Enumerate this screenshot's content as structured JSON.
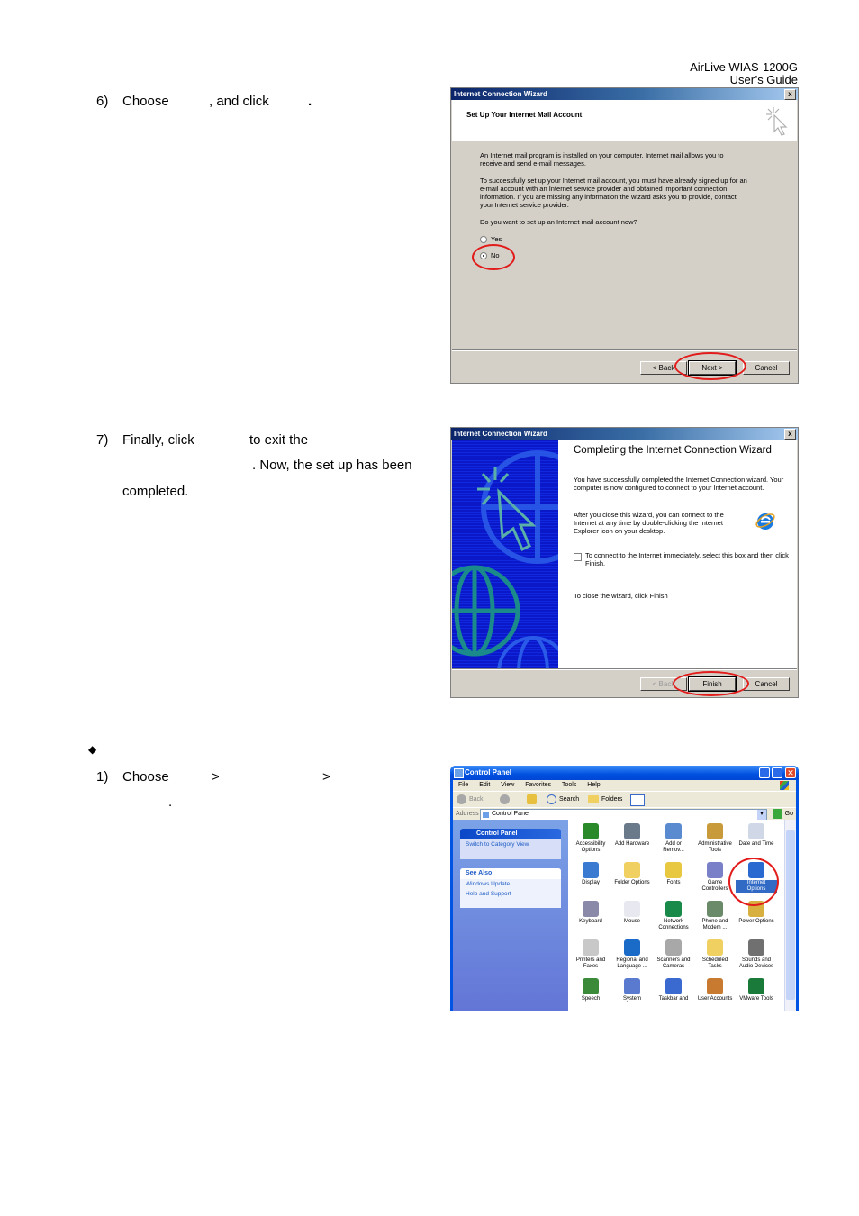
{
  "header": {
    "line1": "AirLive  WIAS-1200G",
    "line2": "User’s  Guide"
  },
  "steps": {
    "s6": {
      "num": "6)",
      "a": "Choose",
      "b": ", and click",
      "c": "."
    },
    "s7": {
      "num": "7)",
      "a": "Finally, click",
      "b": "to exit the",
      "c": ". Now, the set up has been",
      "d": "completed."
    },
    "bullet": "◆",
    "s1": {
      "num": "1)",
      "a": "Choose",
      "gt1": ">",
      "gt2": ">",
      "dot": "."
    }
  },
  "wizard1": {
    "title": "Internet Connection Wizard",
    "close": "x",
    "heading": "Set Up Your Internet Mail Account",
    "p1": "An Internet mail program is installed on your computer. Internet mail allows you to receive and send e-mail messages.",
    "p2": "To successfully set up your Internet mail account, you must have already signed up for an e-mail account with an Internet service provider and obtained important connection information. If you are missing any information the wizard asks you to provide, contact your Internet service provider.",
    "question": "Do you want to set up an Internet mail account now?",
    "options": [
      {
        "label": "Yes",
        "selected": false
      },
      {
        "label": "No",
        "selected": true
      }
    ],
    "buttons": {
      "back": "< Back",
      "next": "Next >",
      "cancel": "Cancel"
    }
  },
  "wizard2": {
    "title": "Internet Connection Wizard",
    "close": "x",
    "heading": "Completing the Internet Connection Wizard",
    "p1": "You have successfully completed the Internet Connection wizard. Your computer is now configured to connect to your Internet account.",
    "p2": "After you close this wizard, you can connect to the Internet at any time by double-clicking the Internet Explorer icon on your desktop.",
    "checkbox": {
      "label": "To connect to the Internet immediately, select this box and then click Finish.",
      "checked": false
    },
    "p3": "To close the wizard, click Finish",
    "buttons": {
      "back": "< Back",
      "finish": "Finish",
      "cancel": "Cancel"
    }
  },
  "control_panel": {
    "title": "Control Panel",
    "menu": [
      "File",
      "Edit",
      "View",
      "Favorites",
      "Tools",
      "Help"
    ],
    "toolbar": {
      "back": "Back",
      "search": "Search",
      "folders": "Folders"
    },
    "address": {
      "label": "Address",
      "value": "Control Panel",
      "go": "Go"
    },
    "panes": [
      {
        "title": "Control Panel",
        "items": [
          "Switch to Category View"
        ]
      },
      {
        "title": "See Also",
        "items": [
          "Windows Update",
          "Help and Support"
        ]
      }
    ],
    "icons": [
      {
        "l1": "Accessibility",
        "l2": "Options",
        "color": "#2a8a2a"
      },
      {
        "l1": "Add Hardware",
        "l2": "",
        "color": "#6a7a8a"
      },
      {
        "l1": "Add or",
        "l2": "Remov...",
        "color": "#5a8ad0"
      },
      {
        "l1": "Administrative",
        "l2": "Tools",
        "color": "#c89a3a"
      },
      {
        "l1": "Date and Time",
        "l2": "",
        "color": "#d0d8e8"
      },
      {
        "l1": "Display",
        "l2": "",
        "color": "#3a7ad0"
      },
      {
        "l1": "Folder Options",
        "l2": "",
        "color": "#f0d060"
      },
      {
        "l1": "Fonts",
        "l2": "",
        "color": "#e8c840"
      },
      {
        "l1": "Game",
        "l2": "Controllers",
        "color": "#7a80c8"
      },
      {
        "l1": "Internet",
        "l2": "Options",
        "color": "#2a6ad0",
        "selected": true
      },
      {
        "l1": "Keyboard",
        "l2": "",
        "color": "#8a8aa8"
      },
      {
        "l1": "Mouse",
        "l2": "",
        "color": "#e8e8f0"
      },
      {
        "l1": "Network",
        "l2": "Connections",
        "color": "#1a8a4a"
      },
      {
        "l1": "Phone and",
        "l2": "Modem ...",
        "color": "#6a8a6a"
      },
      {
        "l1": "Power Options",
        "l2": "",
        "color": "#d8b040"
      },
      {
        "l1": "Printers and",
        "l2": "Faxes",
        "color": "#c8c8c8"
      },
      {
        "l1": "Regional and",
        "l2": "Language ...",
        "color": "#1a6ac8"
      },
      {
        "l1": "Scanners and",
        "l2": "Cameras",
        "color": "#a8a8a8"
      },
      {
        "l1": "Scheduled",
        "l2": "Tasks",
        "color": "#f0d060"
      },
      {
        "l1": "Sounds and",
        "l2": "Audio Devices",
        "color": "#707070"
      },
      {
        "l1": "Speech",
        "l2": "",
        "color": "#3a8a3a"
      },
      {
        "l1": "System",
        "l2": "",
        "color": "#5a7ad0"
      },
      {
        "l1": "Taskbar and",
        "l2": "",
        "color": "#3a6ad0"
      },
      {
        "l1": "User Accounts",
        "l2": "",
        "color": "#c87a30"
      },
      {
        "l1": "VMware Tools",
        "l2": "",
        "color": "#1a7a3a"
      }
    ]
  }
}
